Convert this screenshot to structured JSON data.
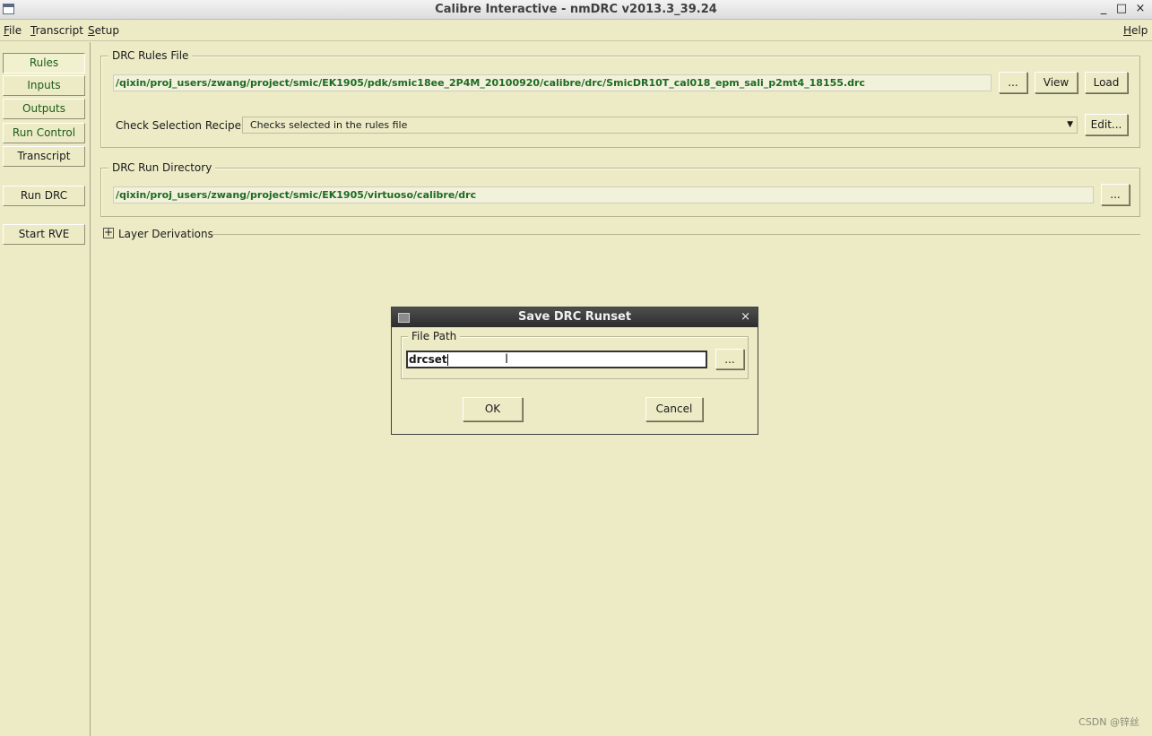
{
  "window": {
    "title": "Calibre Interactive - nmDRC v2013.3_39.24"
  },
  "menu": {
    "file": "File",
    "transcript": "Transcript",
    "setup": "Setup",
    "help": "Help"
  },
  "nav": {
    "rules": "Rules",
    "inputs": "Inputs",
    "outputs": "Outputs",
    "run_control": "Run Control",
    "transcript": "Transcript",
    "run_drc": "Run DRC",
    "start_rve": "Start RVE"
  },
  "rules_file": {
    "label": "DRC Rules File",
    "path": "/qixin/proj_users/zwang/project/smic/EK1905/pdk/smic18ee_2P4M_20100920/calibre/drc/SmicDR10T_cal018_epm_sali_p2mt4_18155.drc",
    "browse": "...",
    "view": "View",
    "load": "Load",
    "recipe_label": "Check Selection Recipe:",
    "recipe_value": "Checks selected in the rules file",
    "edit": "Edit..."
  },
  "run_dir": {
    "label": "DRC Run Directory",
    "path": "/qixin/proj_users/zwang/project/smic/EK1905/virtuoso/calibre/drc",
    "browse": "..."
  },
  "layer_derivations": {
    "label": "Layer Derivations",
    "expander": "+"
  },
  "dialog": {
    "title": "Save DRC Runset",
    "group_label": "File Path",
    "value": "drcset",
    "browse": "...",
    "ok": "OK",
    "cancel": "Cancel",
    "close": "×"
  },
  "watermark": "CSDN @锌丝"
}
